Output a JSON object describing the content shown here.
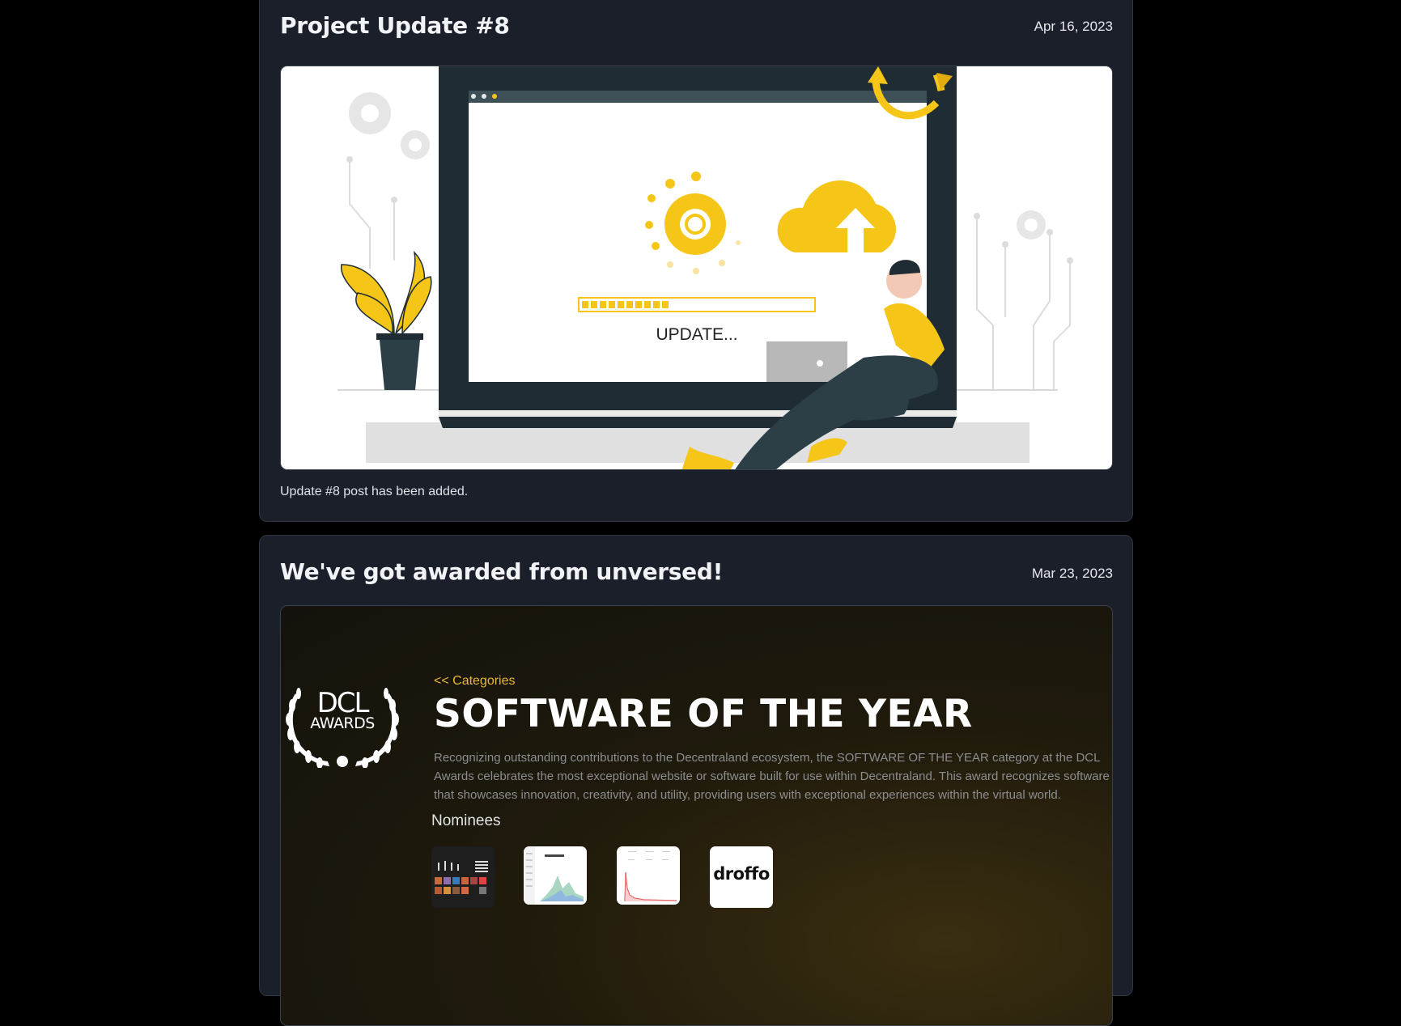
{
  "posts": [
    {
      "title": "Project Update #8",
      "date": "Apr 16, 2023",
      "body": "Update #8 post has been added.",
      "image": {
        "progress_text": "UPDATE...",
        "progress_fraction": 0.38
      }
    },
    {
      "title": "We've got awarded from unversed!",
      "date": "Mar 23, 2023",
      "award": {
        "logo_line1": "DCL",
        "logo_line2": "AWARDS",
        "back_link": "<< Categories",
        "title": "SOFTWARE OF THE YEAR",
        "description": "Recognizing outstanding contributions to the Decentraland ecosystem, the SOFTWARE OF THE YEAR category at the DCL Awards celebrates the most exceptional website or software built for use within Decentraland. This award recognizes software that showcases innovation, creativity, and utility, providing users with exceptional experiences within the virtual world.",
        "nominees_label": "Nominees",
        "nominees": [
          {
            "name": ""
          },
          {
            "name": ""
          },
          {
            "name": ""
          },
          {
            "name": "droffo"
          }
        ]
      }
    }
  ],
  "colors": {
    "page_bg": "#000000",
    "card_bg": "#1b1f2a",
    "accent_yellow": "#f5c518",
    "award_gold": "#e8b836"
  }
}
